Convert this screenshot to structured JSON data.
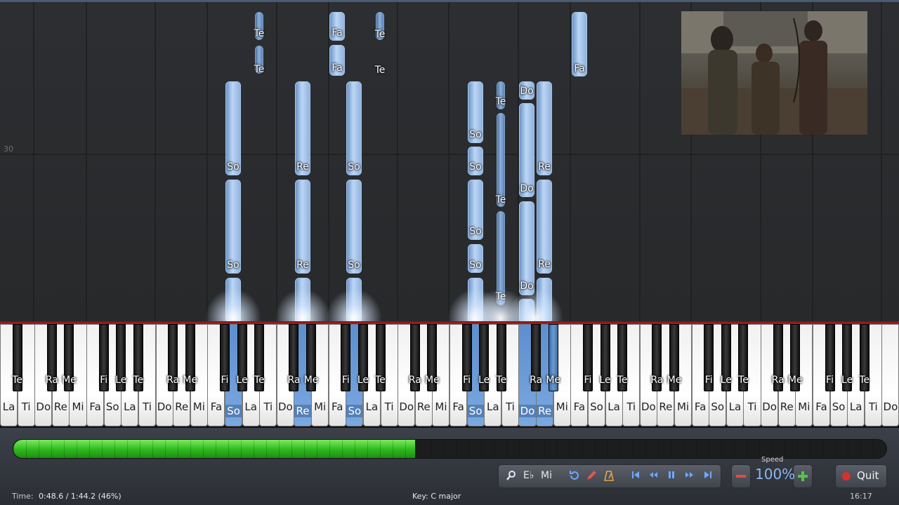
{
  "note_area": {
    "measure_number": "30"
  },
  "keyboard": {
    "white_keys": [
      "La",
      "Ti",
      "Do",
      "Re",
      "Mi",
      "Fa",
      "So",
      "La",
      "Ti",
      "Do",
      "Re",
      "Mi",
      "Fa",
      "So",
      "La",
      "Ti",
      "Do",
      "Re",
      "Mi",
      "Fa",
      "So",
      "La",
      "Ti",
      "Do",
      "Re",
      "Mi",
      "Fa",
      "So",
      "La",
      "Ti",
      "Do",
      "Re",
      "Mi",
      "Fa",
      "So",
      "La",
      "Ti",
      "Do",
      "Re",
      "Mi",
      "Fa",
      "So",
      "La",
      "Ti",
      "Do",
      "Re",
      "Mi",
      "Fa",
      "So",
      "La",
      "Ti",
      "Do"
    ],
    "black_keys": [
      "Te",
      "Ra",
      "Me",
      "Fi",
      "Le",
      "Te",
      "Ra",
      "Me",
      "Fi",
      "Le",
      "Te",
      "Ra",
      "Me",
      "Fi",
      "Le",
      "Te",
      "Ra",
      "Me",
      "Fi",
      "Le",
      "Te",
      "Ra",
      "Me",
      "Fi",
      "Le",
      "Te",
      "Ra",
      "Me",
      "Fi",
      "Le",
      "Te",
      "Ra",
      "Me",
      "Fi",
      "Le",
      "Te"
    ]
  },
  "controls": {
    "search_icon": "magnifier-icon",
    "key_label": "E♭",
    "solfege_label": "Mi",
    "speed_label": "Speed",
    "speed_value": "100%",
    "quit_label": "Quit"
  },
  "status": {
    "time_label": "Time:",
    "time_value": "0:48.6 / 1:44.2 (46%)",
    "key_text": "Key: C major",
    "clock": "16:17"
  },
  "progress": 0.46,
  "colors": {
    "note_blue": "#9fc2ee",
    "progress_green": "#2db81d",
    "keyboard_red": "#a52226"
  }
}
